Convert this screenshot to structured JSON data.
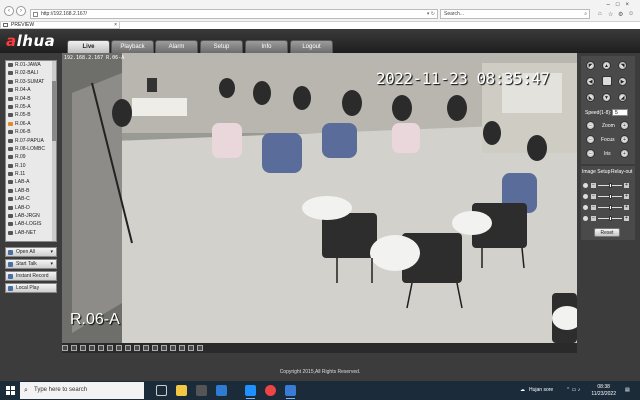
{
  "browser": {
    "url": "http://192.168.2.167/",
    "search_placeholder": "Search...",
    "tab_title": "PREVIEW"
  },
  "app": {
    "logo": "alhua",
    "menu": [
      "Live",
      "Playback",
      "Alarm",
      "Setup",
      "Info",
      "Logout"
    ],
    "active_menu": "Live"
  },
  "channels": [
    "R.01-JAWA",
    "R.02-BALI",
    "R.03-SUMAT",
    "R.04-A",
    "R.04-B",
    "R.05-A",
    "R.05-B",
    "R.06-A",
    "R.06-B",
    "R.07-PAPUA",
    "R.08-LOMBC",
    "R.09",
    "R.10",
    "R.11",
    "LAB-A",
    "LAB-B",
    "LAB-C",
    "LAB-D",
    "LAB-JRGN",
    "LAB-LOGIS",
    "LAB-NET"
  ],
  "left_buttons": {
    "open_all": "Open All",
    "start_talk": "Start Talk",
    "instant_record": "Instant Record",
    "local_play": "Local Play"
  },
  "video": {
    "osd_info": "192.168.2.167 R.06-A",
    "timestamp": "2022-11-23 08:35:47",
    "camera_name": "R.06-A"
  },
  "ptz": {
    "speed_label": "Speed(1-8):",
    "speed_value": "5",
    "zoom_label": "Zoom",
    "focus_label": "Focus",
    "iris_label": "Iris"
  },
  "image_setup": {
    "tab_image": "Image Setup",
    "tab_relay": "Relay-out",
    "reset_label": "Reset",
    "levels": [
      0.5,
      0.5,
      0.5,
      0.5
    ]
  },
  "footer": {
    "copyright": "Copyright 2015,All Rights Reserved."
  },
  "taskbar": {
    "search_placeholder": "Type here to search",
    "weather": "Hujan sore",
    "time": "08:38",
    "date": "11/23/2022"
  }
}
